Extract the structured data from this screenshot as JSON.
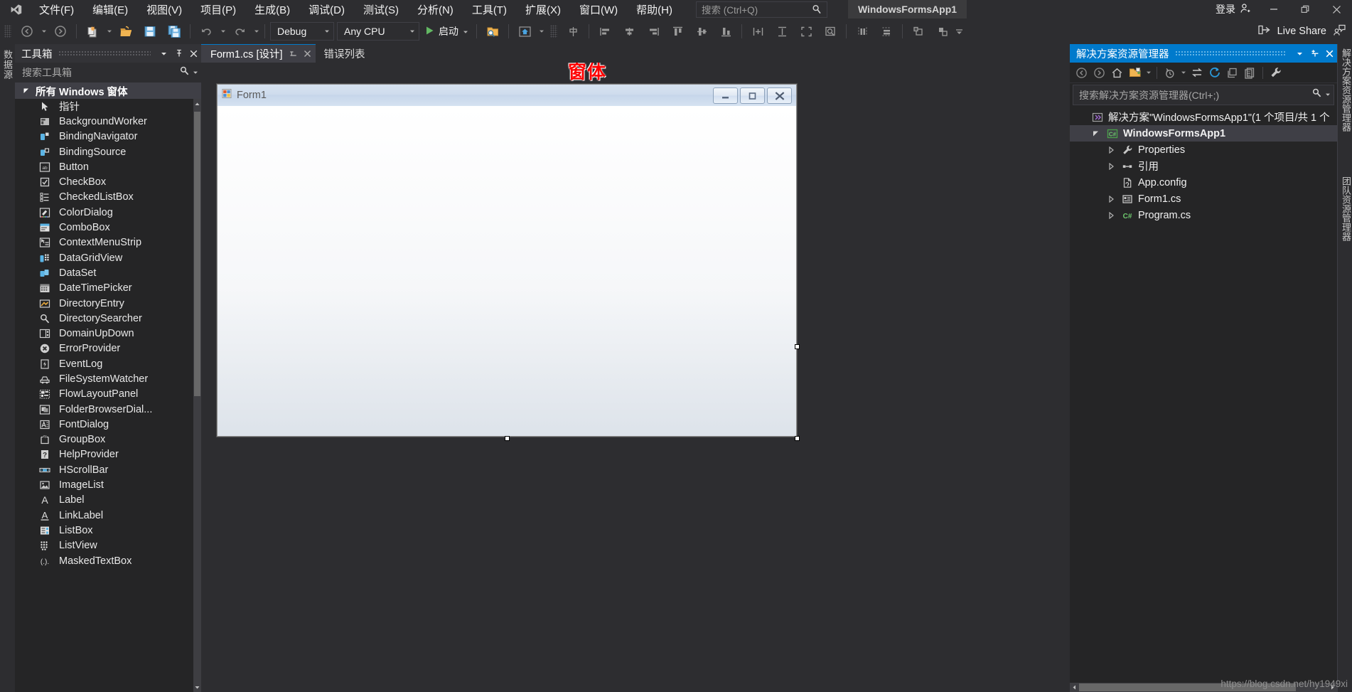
{
  "titlebar": {
    "logo_icon": "visual-studio-logo",
    "menus": [
      "文件(F)",
      "编辑(E)",
      "视图(V)",
      "项目(P)",
      "生成(B)",
      "调试(D)",
      "测试(S)",
      "分析(N)",
      "工具(T)",
      "扩展(X)",
      "窗口(W)",
      "帮助(H)"
    ],
    "search_placeholder": "搜索 (Ctrl+Q)",
    "search_icon": "magnifier-icon",
    "project_badge": "WindowsFormsApp1",
    "signin_label": "登录",
    "signin_icon": "person-add-icon",
    "minimize_icon": "minimize-icon",
    "maximize_icon": "restore-icon",
    "close_icon": "close-icon"
  },
  "toolbar": {
    "back_icon": "navigate-back-icon",
    "forward_icon": "navigate-forward-icon",
    "new_item_icon": "new-item-icon",
    "open_icon": "open-folder-icon",
    "save_icon": "save-icon",
    "save_all_icon": "save-all-icon",
    "undo_icon": "undo-icon",
    "redo_icon": "redo-icon",
    "config_value": "Debug",
    "platform_value": "Any CPU",
    "run_label": "启动",
    "run_icon": "play-icon",
    "dropdown_icon": "chevron-down-icon",
    "find_icon": "find-in-files-icon",
    "home_icon": "home-icon",
    "align_icons": [
      "align-lefts-icon",
      "align-centers-icon",
      "align-rights-icon",
      "align-tops-icon",
      "align-middles-icon",
      "align-bottoms-icon"
    ],
    "size_icons": [
      "make-same-width-icon",
      "make-same-height-icon",
      "make-same-size-icon",
      "size-to-grid-icon"
    ],
    "space_icons": [
      "make-horizontal-spacing-equal-icon",
      "make-vertical-spacing-equal-icon"
    ],
    "order_icons": [
      "bring-to-front-icon",
      "send-to-back-icon"
    ],
    "overflow_icon": "toolbar-overflow-icon",
    "live_share_label": "Live Share",
    "live_share_icon": "live-share-icon",
    "live_share_feedback_icon": "feedback-person-icon"
  },
  "left_vertical_tab": {
    "label": "数据源"
  },
  "right_vertical_tabs": [
    {
      "label": "解决方案资源管理器"
    },
    {
      "label": "团队资源管理器"
    }
  ],
  "toolbox": {
    "title": "工具箱",
    "dropdown_icon": "chevron-down-icon",
    "pin_icon": "pin-icon",
    "close_icon": "close-icon",
    "search_placeholder": "搜索工具箱",
    "search_icon": "magnifier-icon",
    "search_dropdown_icon": "chevron-down-icon",
    "group_label": "所有 Windows 窗体",
    "group_expander_icon": "triangle-down-icon",
    "items": [
      {
        "label": "指针",
        "icon": "pointer-icon"
      },
      {
        "label": "BackgroundWorker",
        "icon": "backgroundworker-icon"
      },
      {
        "label": "BindingNavigator",
        "icon": "bindingnavigator-icon"
      },
      {
        "label": "BindingSource",
        "icon": "bindingsource-icon"
      },
      {
        "label": "Button",
        "icon": "button-icon"
      },
      {
        "label": "CheckBox",
        "icon": "checkbox-icon"
      },
      {
        "label": "CheckedListBox",
        "icon": "checkedlistbox-icon"
      },
      {
        "label": "ColorDialog",
        "icon": "colordialog-icon"
      },
      {
        "label": "ComboBox",
        "icon": "combobox-icon"
      },
      {
        "label": "ContextMenuStrip",
        "icon": "contextmenustrip-icon"
      },
      {
        "label": "DataGridView",
        "icon": "datagridview-icon"
      },
      {
        "label": "DataSet",
        "icon": "dataset-icon"
      },
      {
        "label": "DateTimePicker",
        "icon": "datetimepicker-icon"
      },
      {
        "label": "DirectoryEntry",
        "icon": "directoryentry-icon"
      },
      {
        "label": "DirectorySearcher",
        "icon": "directorysearcher-icon"
      },
      {
        "label": "DomainUpDown",
        "icon": "domainupdown-icon"
      },
      {
        "label": "ErrorProvider",
        "icon": "errorprovider-icon"
      },
      {
        "label": "EventLog",
        "icon": "eventlog-icon"
      },
      {
        "label": "FileSystemWatcher",
        "icon": "filesystemwatcher-icon"
      },
      {
        "label": "FlowLayoutPanel",
        "icon": "flowlayoutpanel-icon"
      },
      {
        "label": "FolderBrowserDial...",
        "icon": "folderbrowserdialog-icon"
      },
      {
        "label": "FontDialog",
        "icon": "fontdialog-icon"
      },
      {
        "label": "GroupBox",
        "icon": "groupbox-icon"
      },
      {
        "label": "HelpProvider",
        "icon": "helpprovider-icon"
      },
      {
        "label": "HScrollBar",
        "icon": "hscrollbar-icon"
      },
      {
        "label": "ImageList",
        "icon": "imagelist-icon"
      },
      {
        "label": "Label",
        "icon": "label-icon"
      },
      {
        "label": "LinkLabel",
        "icon": "linklabel-icon"
      },
      {
        "label": "ListBox",
        "icon": "listbox-icon"
      },
      {
        "label": "ListView",
        "icon": "listview-icon"
      },
      {
        "label": "MaskedTextBox",
        "icon": "maskedtextbox-icon"
      }
    ]
  },
  "tabstrip": {
    "active_tab": "Form1.cs [设计]",
    "active_tab_pin_icon": "pin-icon",
    "active_tab_close_icon": "close-icon",
    "inactive_tab": "错误列表"
  },
  "designer": {
    "annotation": "窗体",
    "annotation_color": "#ff0000",
    "form": {
      "title": "Form1",
      "icon": "form-icon",
      "minimize_icon": "minimize-icon",
      "maximize_icon": "maximize-icon",
      "close_icon": "close-icon"
    }
  },
  "solution_explorer": {
    "title": "解决方案资源管理器",
    "dropdown_icon": "chevron-down-icon",
    "pin_icon": "pin-icon",
    "close_icon": "close-icon",
    "toolbar_icons": [
      "navigate-back-icon",
      "navigate-forward-icon",
      "home-icon",
      "show-all-files-icon",
      "chevron-down-icon",
      "pending-changes-icon",
      "chevron-down-icon",
      "sync-with-active-document-icon",
      "refresh-icon",
      "collapse-all-icon",
      "properties-window-icon",
      "wrench-icon"
    ],
    "search_placeholder": "搜索解决方案资源管理器(Ctrl+;)",
    "search_icon": "magnifier-icon",
    "search_dropdown_icon": "chevron-down-icon",
    "tree": [
      {
        "label": "解决方案\"WindowsFormsApp1\"(1 个项目/共 1 个",
        "icon": "solution-icon",
        "indent": 0,
        "twist": "",
        "bold": false
      },
      {
        "label": "WindowsFormsApp1",
        "icon": "csharp-project-icon",
        "indent": 1,
        "twist": "expanded",
        "bold": true
      },
      {
        "label": "Properties",
        "icon": "wrench-icon",
        "indent": 2,
        "twist": "collapsed",
        "bold": false
      },
      {
        "label": "引用",
        "icon": "references-icon",
        "indent": 2,
        "twist": "collapsed",
        "bold": false
      },
      {
        "label": "App.config",
        "icon": "config-file-icon",
        "indent": 2,
        "twist": "",
        "bold": false
      },
      {
        "label": "Form1.cs",
        "icon": "form-file-icon",
        "indent": 2,
        "twist": "collapsed",
        "bold": false
      },
      {
        "label": "Program.cs",
        "icon": "csharp-file-icon",
        "indent": 2,
        "twist": "collapsed",
        "bold": false
      }
    ]
  },
  "watermark": "https://blog.csdn.net/hy1949xi"
}
